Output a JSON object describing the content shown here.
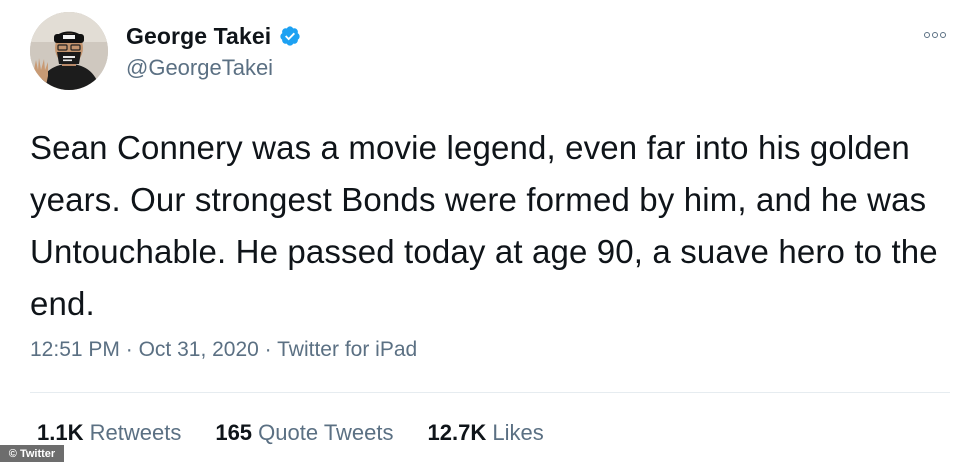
{
  "author": {
    "display_name": "George Takei",
    "handle": "@GeorgeTakei",
    "verified": true,
    "avatar_icon": "profile-photo"
  },
  "tweet": {
    "text": "Sean Connery was a movie legend, even far into his golden years. Our strongest Bonds were formed by him, and he was Untouchable. He passed today at age 90, a suave hero to the end.",
    "time": "12:51 PM",
    "date": "Oct 31, 2020",
    "separator": "·",
    "source": "Twitter for iPad"
  },
  "stats": {
    "retweets_value": "1.1K",
    "retweets_label": "Retweets",
    "quote_tweets_value": "165",
    "quote_tweets_label": "Quote Tweets",
    "likes_value": "12.7K",
    "likes_label": "Likes"
  },
  "watermark": "© Twitter",
  "colors": {
    "verified_blue": "#1da1f2",
    "secondary_text": "#5b7083",
    "primary_text": "#0f1419",
    "divider": "#e6ecf0"
  }
}
